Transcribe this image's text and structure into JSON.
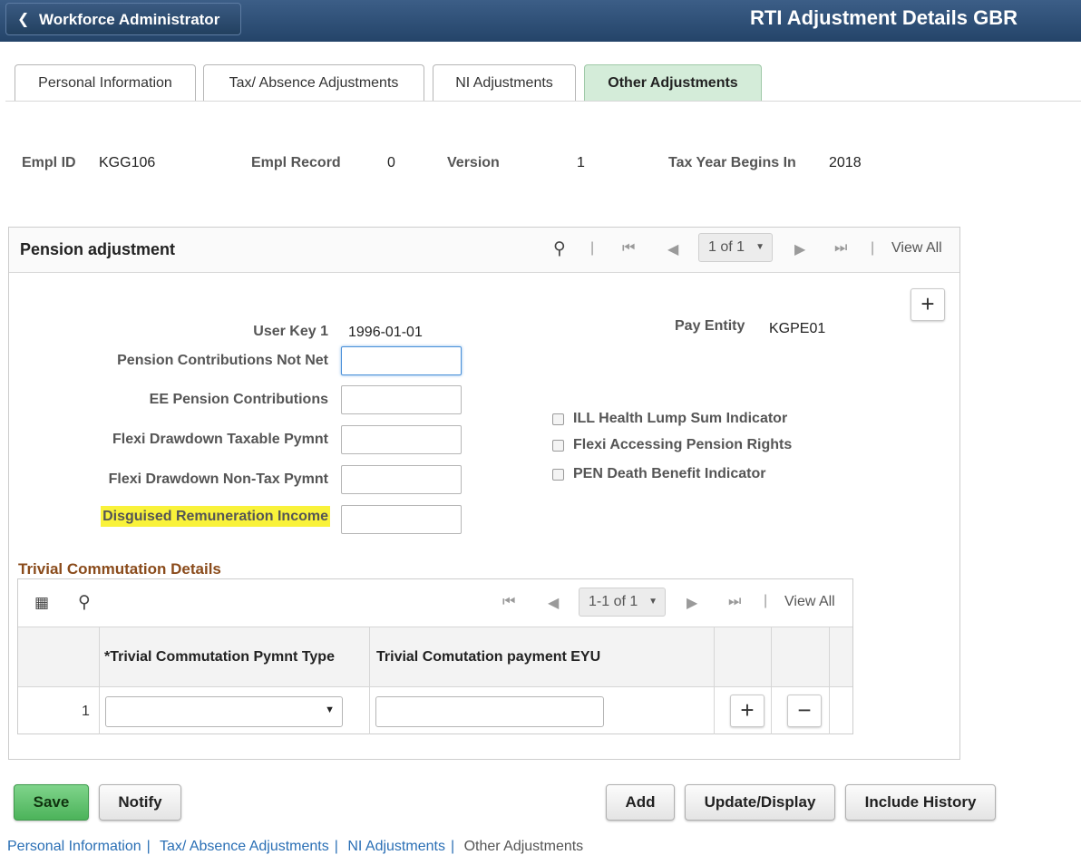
{
  "header": {
    "back_label": "Workforce Administrator",
    "page_title": "RTI Adjustment Details GBR"
  },
  "tabs": [
    {
      "label": "Personal Information",
      "active": false
    },
    {
      "label": "Tax/ Absence Adjustments",
      "active": false
    },
    {
      "label": "NI Adjustments",
      "active": false
    },
    {
      "label": "Other Adjustments",
      "active": true
    }
  ],
  "keys": {
    "empl_id_label": "Empl ID",
    "empl_id": "KGG106",
    "empl_record_label": "Empl Record",
    "empl_record": "0",
    "version_label": "Version",
    "version": "1",
    "tax_year_label": "Tax Year Begins In",
    "tax_year": "2018"
  },
  "pension": {
    "title": "Pension adjustment",
    "pager": "1 of 1",
    "view_all": "View All",
    "user_key_label": "User Key 1",
    "user_key": "1996-01-01",
    "pay_entity_label": "Pay Entity",
    "pay_entity": "KGPE01",
    "fields": [
      {
        "label": "Pension Contributions Not Net",
        "value": ""
      },
      {
        "label": "EE Pension Contributions",
        "value": ""
      },
      {
        "label": "Flexi Drawdown Taxable Pymnt",
        "value": ""
      },
      {
        "label": "Flexi Drawdown Non-Tax Pymnt",
        "value": ""
      },
      {
        "label": "Disguised Remuneration Income",
        "value": ""
      }
    ],
    "checkboxes": [
      {
        "label": "ILL Health Lump Sum Indicator",
        "checked": false
      },
      {
        "label": "Flexi Accessing Pension Rights",
        "checked": false
      },
      {
        "label": "PEN Death Benefit Indicator",
        "checked": false
      }
    ]
  },
  "trivial": {
    "title": "Trivial Commutation Details",
    "pager": "1-1 of 1",
    "view_all": "View All",
    "col1": "*Trivial Commutation Pymnt Type",
    "col2": "Trivial Comutation payment EYU",
    "row_number": "1",
    "row_type": "",
    "row_payment": ""
  },
  "buttons": {
    "save": "Save",
    "notify": "Notify",
    "add": "Add",
    "update_display": "Update/Display",
    "include_history": "Include History"
  },
  "breadcrumbs": [
    "Personal Information",
    "Tax/ Absence Adjustments",
    "NI Adjustments",
    "Other Adjustments"
  ],
  "colors": {
    "header": "#2f5079",
    "active_tab": "#d4ecd9",
    "highlight": "#f9f23a",
    "save_button": "#5cbf6a",
    "subsection_title": "#8a4b1b"
  }
}
